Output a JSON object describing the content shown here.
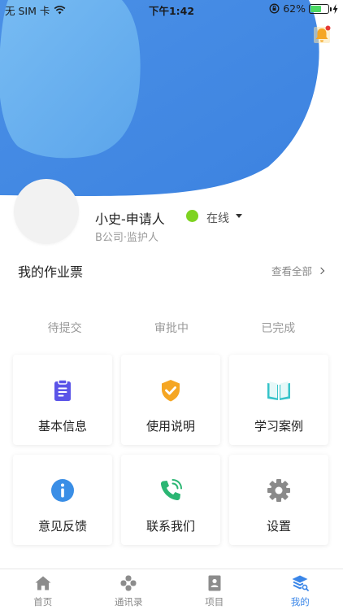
{
  "status_bar": {
    "carrier": "无 SIM 卡",
    "time": "下午1:42",
    "battery_pct": "62%",
    "battery_level": 0.62
  },
  "profile": {
    "name": "小史-申请人",
    "status": "在线",
    "subtitle": "B公司·监护人"
  },
  "tickets": {
    "title": "我的作业票",
    "view_all": "查看全部",
    "tabs": [
      "待提交",
      "审批中",
      "已完成"
    ]
  },
  "grid": [
    {
      "label": "基本信息",
      "icon": "clipboard-icon",
      "color": "#5b54e8"
    },
    {
      "label": "使用说明",
      "icon": "shield-check-icon",
      "color": "#f5a623"
    },
    {
      "label": "学习案例",
      "icon": "open-book-icon",
      "color": "#36c3c9"
    },
    {
      "label": "意见反馈",
      "icon": "info-icon",
      "color": "#3a8ee6"
    },
    {
      "label": "联系我们",
      "icon": "phone-icon",
      "color": "#2bb673"
    },
    {
      "label": "设置",
      "icon": "gear-icon",
      "color": "#8a8a8a"
    }
  ],
  "tab_bar": {
    "items": [
      {
        "label": "首页",
        "icon": "home-icon",
        "active": false
      },
      {
        "label": "通讯录",
        "icon": "contacts-icon",
        "active": false
      },
      {
        "label": "项目",
        "icon": "project-icon",
        "active": false
      },
      {
        "label": "我的",
        "icon": "profile-stack-icon",
        "active": true
      }
    ],
    "active_color": "#3a86e8",
    "inactive_color": "#888888"
  },
  "colors": {
    "hero_primary": "#3f86e2",
    "hero_light": "#62adef",
    "online": "#7ed321",
    "notification_bell": "#f5a623",
    "notification_dot": "#e53935"
  }
}
